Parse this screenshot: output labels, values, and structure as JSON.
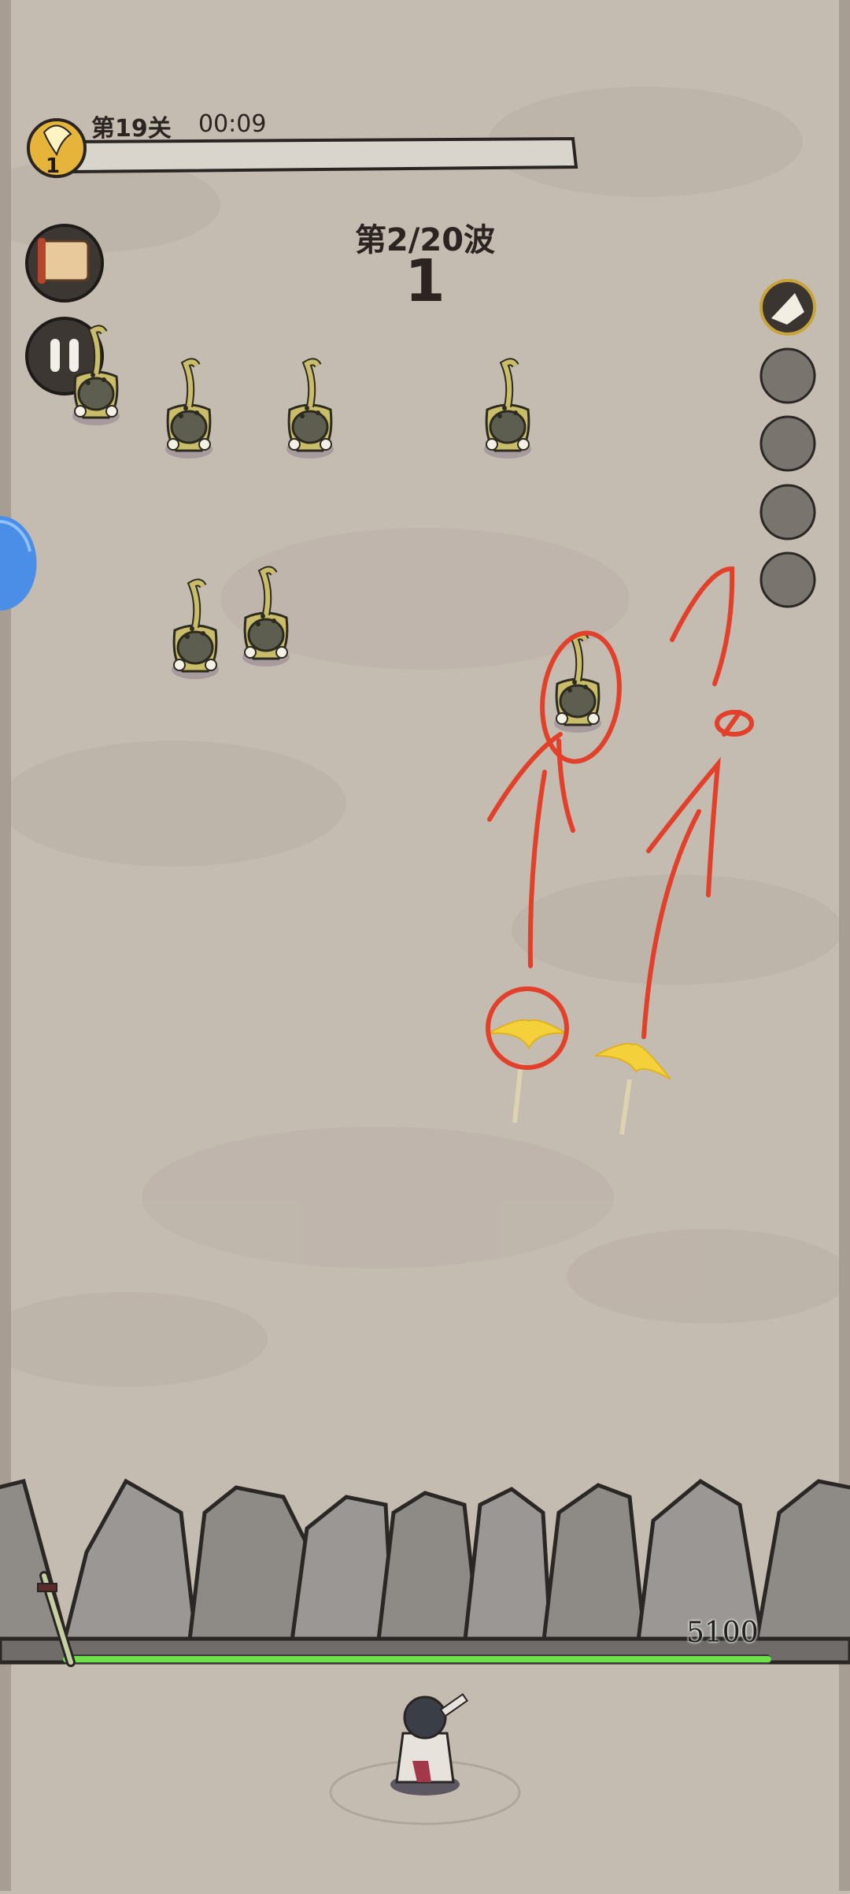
{
  "hud": {
    "level_label": "第19关",
    "timer": "00:09",
    "player_level": "1",
    "level_progress": 0.0
  },
  "wave": {
    "title": "第2/20波",
    "count": "1"
  },
  "wall": {
    "hp_value": "5100",
    "hp_fraction": 1.0
  },
  "skills": {
    "slots": [
      "swift-bird-skill",
      "empty-slot",
      "empty-slot",
      "empty-slot",
      "empty-slot"
    ]
  },
  "buttons": {
    "scroll_icon": "scroll-map-icon",
    "pause_icon": "pause-icon"
  },
  "colors": {
    "ground": "#c4bbb1",
    "wall_hp": "#6ee04c",
    "annotation": "#e2402b",
    "projectile": "#f4d13a"
  }
}
